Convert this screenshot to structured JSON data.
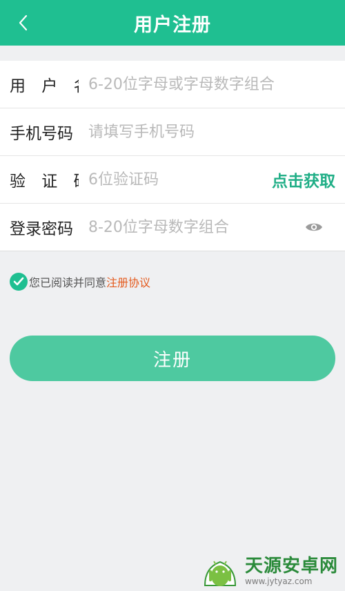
{
  "header": {
    "title": "用户注册"
  },
  "form": {
    "username": {
      "label": "用 户 名",
      "placeholder": "6-20位字母或字母数字组合"
    },
    "phone": {
      "label": "手机号码",
      "placeholder": "请填写手机号码"
    },
    "code": {
      "label": "验 证 码",
      "placeholder": "6位验证码",
      "action": "点击获取"
    },
    "password": {
      "label": "登录密码",
      "placeholder": "8-20位字母数字组合"
    }
  },
  "agreement": {
    "text": "您已阅读并同意",
    "link": "注册协议",
    "checked": true
  },
  "submit": {
    "label": "注册"
  },
  "watermark": {
    "name": "天源安卓网",
    "url": "www.jytyaz.com"
  },
  "colors": {
    "primary": "#1fbf91",
    "button": "#4ec9a0",
    "link": "#e45a1d",
    "background": "#eff0f2"
  },
  "icons": [
    "back-arrow-icon",
    "eye-icon",
    "check-icon",
    "android-logo-icon"
  ]
}
